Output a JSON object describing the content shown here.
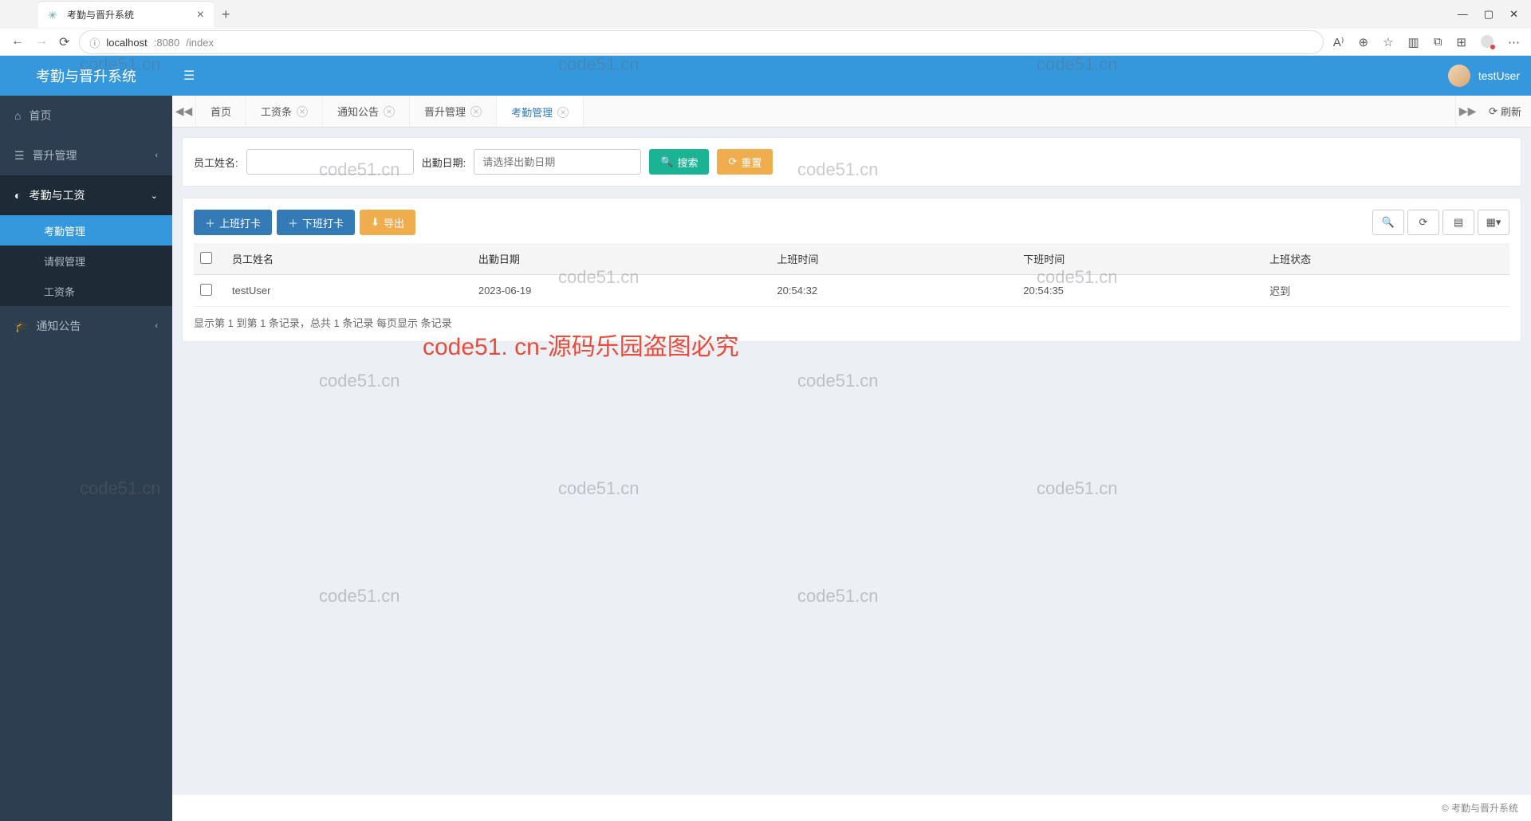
{
  "browser": {
    "tab_title": "考勤与晋升系统",
    "url_host": "localhost",
    "url_port": ":8080",
    "url_path": "/index"
  },
  "brand": "考勤与晋升系统",
  "user": {
    "name": "testUser"
  },
  "sidebar": {
    "home": "首页",
    "promotion": "晋升管理",
    "attendance_pay": "考勤与工资",
    "sub": {
      "attendance": "考勤管理",
      "leave": "请假管理",
      "salary": "工资条"
    },
    "notice": "通知公告"
  },
  "tabs": {
    "home": "首页",
    "salary": "工资条",
    "notice": "通知公告",
    "promotion": "晋升管理",
    "attendance": "考勤管理",
    "refresh": "刷新"
  },
  "search": {
    "name_label": "员工姓名:",
    "date_label": "出勤日期:",
    "date_placeholder": "请选择出勤日期",
    "search_btn": "搜索",
    "reset_btn": "重置"
  },
  "toolbar": {
    "clockin": "上班打卡",
    "clockout": "下班打卡",
    "export": "导出"
  },
  "table": {
    "headers": {
      "name": "员工姓名",
      "date": "出勤日期",
      "in_time": "上班时间",
      "out_time": "下班时间",
      "status": "上班状态"
    },
    "rows": [
      {
        "name": "testUser",
        "date": "2023-06-19",
        "in_time": "20:54:32",
        "out_time": "20:54:35",
        "status": "迟到"
      }
    ]
  },
  "pager": {
    "text": "显示第 1 到第 1 条记录，总共 1 条记录  每页显示  条记录"
  },
  "footer": "© 考勤与晋升系统",
  "watermarks": {
    "small": "code51.cn",
    "big": "code51. cn-源码乐园盗图必究"
  }
}
